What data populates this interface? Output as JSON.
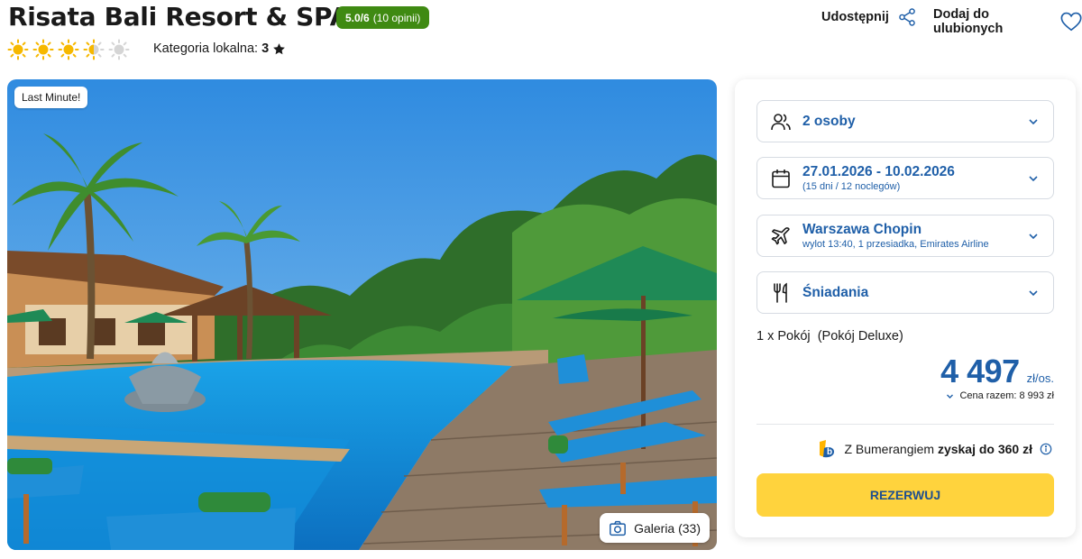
{
  "hotel": {
    "name": "Risata Bali Resort & SPA",
    "rating_score": "5.0/6",
    "rating_count": "(10 opinii)",
    "sun_stars": 3.5,
    "sun_stars_max": 5,
    "local_category_label": "Kategoria lokalna:",
    "local_category_value": "3"
  },
  "actions": {
    "share_label": "Udostępnij",
    "favorite_label": "Dodaj do ulubionych"
  },
  "photo": {
    "badge": "Last Minute!",
    "gallery_label": "Galeria (33)"
  },
  "booking": {
    "travelers": "2 osoby",
    "dates": "27.01.2026 - 10.02.2026",
    "duration": "(15 dni / 12 noclegów)",
    "departure": "Warszawa Chopin",
    "flight_details": "wylot 13:40, 1 przesiadka, Emirates Airline",
    "board": "Śniadania",
    "room": "1 x Pokój  (Pokój Deluxe)",
    "price": "4 497",
    "price_unit": "zł/os.",
    "total": "Cena razem: 8 993 zł",
    "boomerang_prefix": "Z Bumerangiem",
    "boomerang_bold": "zyskaj do 360 zł",
    "book_button": "REZERWUJ"
  },
  "colors": {
    "brand_blue": "#1f5fa8",
    "rating_green": "#3f8a12",
    "cta_yellow": "#ffd33d",
    "sun_yellow": "#f6b800"
  },
  "icons": [
    "sun-icon",
    "star-icon",
    "share-icon",
    "heart-icon",
    "camera-icon",
    "users-icon",
    "calendar-icon",
    "plane-icon",
    "cutlery-icon",
    "chevron-down-icon",
    "boomerang-logo-icon",
    "info-icon"
  ]
}
